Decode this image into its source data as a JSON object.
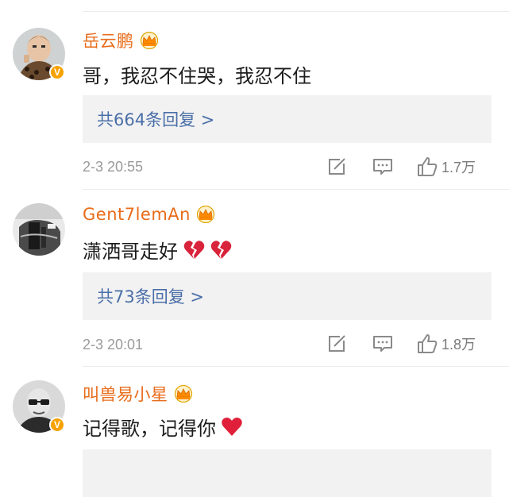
{
  "comments": [
    {
      "username": "岳云鹏",
      "text": "哥，我忍不住哭，我忍不住",
      "emojis": [],
      "reply_label": "共664条回复 >",
      "timestamp": "2-3 20:55",
      "likes": "1.7万",
      "verified": true,
      "avatar": "baby-avatar"
    },
    {
      "username": "Gent7lemAn",
      "text": "潇洒哥走好",
      "emojis": [
        "broken-heart",
        "broken-heart"
      ],
      "reply_label": "共73条回复 >",
      "timestamp": "2-3 20:01",
      "likes": "1.8万",
      "verified": false,
      "avatar": "bw-photo-avatar"
    },
    {
      "username": "叫兽易小星",
      "text": "记得歌，记得你",
      "emojis": [
        "red-heart"
      ],
      "reply_label": "",
      "timestamp": "",
      "likes": "",
      "verified": true,
      "avatar": "bald-man-avatar"
    }
  ],
  "colors": {
    "username": "#e86c1a",
    "reply_link": "#4a6fa8",
    "meta": "#9a9a9a",
    "badge": "#f7a200"
  },
  "icons": [
    "crown-vip-icon",
    "share-icon",
    "comment-icon",
    "like-icon",
    "verified-badge-icon"
  ]
}
